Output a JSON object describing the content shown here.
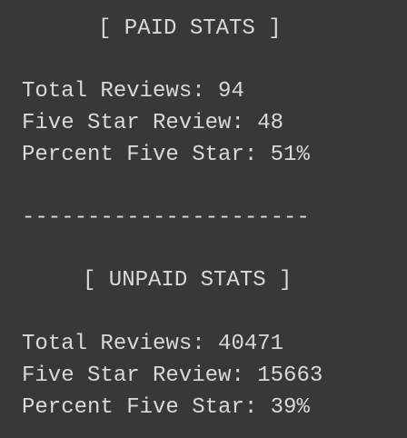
{
  "paid": {
    "heading": "[ PAID STATS ]",
    "total_reviews": "Total Reviews: 94",
    "five_star_reviews": "Five Star Review: 48",
    "percent_five_star": "Percent Five Star: 51%"
  },
  "divider": "----------------------",
  "unpaid": {
    "heading": "[ UNPAID STATS ]",
    "total_reviews": "Total Reviews: 40471",
    "five_star_reviews": "Five Star Review: 15663",
    "percent_five_star": "Percent Five Star: 39%"
  }
}
